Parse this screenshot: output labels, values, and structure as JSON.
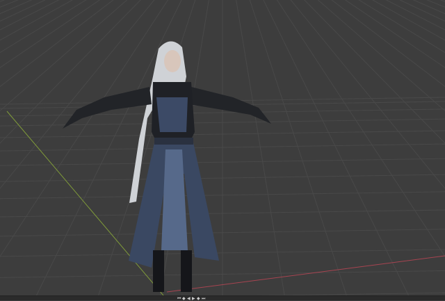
{
  "viewport": {
    "background": "#3d3d3d",
    "grid_color": "#494949",
    "x_axis_color": "#a84451",
    "y_axis_color": "#7f9a3a",
    "object": "character-model"
  },
  "timeline": {
    "controls": [
      {
        "icon": "jump-start-icon",
        "glyph": "⏮"
      },
      {
        "icon": "prev-keyframe-icon",
        "glyph": "◆"
      },
      {
        "icon": "play-reverse-icon",
        "glyph": "◀"
      },
      {
        "icon": "play-icon",
        "glyph": "▶"
      },
      {
        "icon": "next-keyframe-icon",
        "glyph": "◆"
      },
      {
        "icon": "jump-end-icon",
        "glyph": "⏭"
      }
    ]
  }
}
